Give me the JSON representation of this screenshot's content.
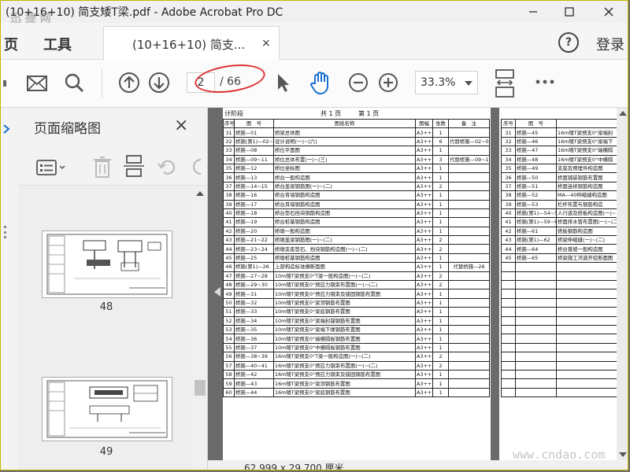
{
  "window": {
    "title": "(10+16+10)  简支矮T梁.pdf - Adobe Acrobat Pro DC",
    "watermark": "迅 捷 网",
    "controls": [
      "minimize",
      "maximize",
      "close"
    ]
  },
  "tabbar": {
    "nav_partial": "页",
    "tools": "工具",
    "doc_tab": "(10+16+10)  简支...",
    "close_glyph": "×",
    "help_glyph": "?",
    "login": "登录"
  },
  "toolbar": {
    "page_current": "2",
    "page_total": "/ 66",
    "zoom": "33.3%"
  },
  "sidebar": {
    "title": "页面缩略图",
    "close_glyph": "×",
    "thumbnails": [
      {
        "label": "48"
      },
      {
        "label": "49"
      }
    ]
  },
  "document": {
    "page1_header": {
      "left": "计阶段",
      "mid": "共 1 页",
      "right": "第 1 页"
    },
    "columns": [
      "序号",
      "图　号",
      "图纸名称",
      "图幅",
      "张数",
      "备　注"
    ],
    "rows": [
      [
        "31",
        "桥施—01",
        "桥梁总体图",
        "A3++",
        "1",
        ""
      ],
      [
        "32",
        "桥施(第1)—02~07",
        "设计说明(一)~(六)",
        "A3++",
        "6",
        "代替桥施—02~07"
      ],
      [
        "33",
        "桥施—08",
        "桥位平面图",
        "A3++",
        "1",
        ""
      ],
      [
        "34",
        "桥施—09~11",
        "桥位总体布置(一)~(三)",
        "A3++",
        "3",
        "代替桥施—09~11"
      ],
      [
        "35",
        "桥施—12",
        "桥位坐标图",
        "A3++",
        "1",
        ""
      ],
      [
        "36",
        "桥施—13",
        "桥台一般构造图",
        "A3++",
        "1",
        ""
      ],
      [
        "37",
        "桥施—14~15",
        "桥台盖梁钢筋图(一)~(二)",
        "A3++",
        "2",
        ""
      ],
      [
        "38",
        "桥施—16",
        "桥台背墙钢筋构造图",
        "A3++",
        "1",
        ""
      ],
      [
        "39",
        "桥施—17",
        "桥台耳墙钢筋构造图",
        "A3++",
        "1",
        ""
      ],
      [
        "40",
        "桥施—18",
        "桥台垫石挡块钢筋构造图",
        "A3++",
        "1",
        ""
      ],
      [
        "41",
        "桥施—19",
        "桥台桩基钢筋构造图",
        "A3++",
        "1",
        ""
      ],
      [
        "42",
        "桥施—20",
        "桥墩一般构造图",
        "A3++",
        "1",
        ""
      ],
      [
        "43",
        "桥施—21~22",
        "桥墩盖梁钢筋图(一)~(二)",
        "A3++",
        "2",
        ""
      ],
      [
        "44",
        "桥施—23~24",
        "桥墩支座垫石、挡块钢筋构造图(一)~(二)",
        "A3++",
        "2",
        ""
      ],
      [
        "45",
        "桥施—25",
        "桥墩桩基钢筋构造图",
        "A3++",
        "1",
        ""
      ],
      [
        "46",
        "桥施(第1)—26",
        "上部构造标准横断面图",
        "A3++",
        "1",
        "代替桥施—26"
      ],
      [
        "47",
        "桥施—27~28",
        "10m矮T梁预支0°T梁一般构造图(一)~(二)",
        "A3++",
        "2",
        ""
      ],
      [
        "48",
        "桥施—29~30",
        "10m矮T梁预支0°预应力钢束布置图(一)~(二)",
        "A3++",
        "2",
        ""
      ],
      [
        "49",
        "桥施—31",
        "10m矮T梁预支0°预应力钢束及锚固钢筋布置图",
        "A3++",
        "1",
        ""
      ],
      [
        "50",
        "桥施—32",
        "10m矮T梁预支0°梁顶钢筋布置图",
        "A3++",
        "1",
        ""
      ],
      [
        "51",
        "桥施—33",
        "10m矮T梁预支0°梁底钢筋布置图",
        "A3++",
        "1",
        ""
      ],
      [
        "52",
        "桥施—34",
        "10m矮T梁预支0°梁端封锚钢筋布置图",
        "A3++",
        "1",
        ""
      ],
      [
        "53",
        "桥施—35",
        "10m矮T梁预支0°梁端下缘钢筋布置图",
        "A3++",
        "1",
        ""
      ],
      [
        "54",
        "桥施—36",
        "10m矮T梁预支0°端横隔板钢筋布置图",
        "A3++",
        "1",
        ""
      ],
      [
        "55",
        "桥施—37",
        "10m矮T梁预支0°中横隔板钢筋布置图",
        "A3++",
        "1",
        ""
      ],
      [
        "56",
        "桥施—38~39",
        "16m矮T梁预支0°T梁一般构造图(一)~(二)",
        "A3++",
        "2",
        ""
      ],
      [
        "57",
        "桥施—40~41",
        "16m矮T梁预支0°预应力钢束布置图(一)~(二)",
        "A3++",
        "2",
        ""
      ],
      [
        "58",
        "桥施—42",
        "16m矮T梁预支0°预应力钢束及锚固钢筋布置图",
        "A3++",
        "1",
        ""
      ],
      [
        "59",
        "桥施—43",
        "16m矮T梁预支0°梁顶钢筋布置图",
        "A3++",
        "1",
        ""
      ],
      [
        "60",
        "桥施—44",
        "16m矮T梁预支0°梁底钢筋布置图",
        "A3++",
        "1",
        ""
      ]
    ],
    "page2_columns": [
      "序号",
      "图　号",
      ""
    ],
    "page2_rows": [
      [
        "31",
        "桥施—45",
        "16m矮T梁预支0°梁端封"
      ],
      [
        "32",
        "桥施—46",
        "16m矮T梁预支0°梁端下"
      ],
      [
        "33",
        "桥施—47",
        "16m矮T梁预支0°端横隔"
      ],
      [
        "34",
        "桥施—48",
        "16m矮T梁预支0°中横隔"
      ],
      [
        "35",
        "桥施—49",
        "支座及预埋件构造图"
      ],
      [
        "36",
        "桥施—50",
        "桥面铺装钢筋布置图"
      ],
      [
        "37",
        "桥施—51",
        "桥面连续钢筋构造图"
      ],
      [
        "38",
        "桥施—52",
        "MA—40伸缩缝构造图"
      ],
      [
        "39",
        "桥施—53",
        "栏杆布置与钢筋构造"
      ],
      [
        "40",
        "桥施(第1)—54~58",
        "人行道及搭板构造图(一)~"
      ],
      [
        "41",
        "桥施(第1)—59~60",
        "桥面排水管布置图(一)~(二"
      ],
      [
        "42",
        "桥施—61",
        "搭板钢筋构造图"
      ],
      [
        "43",
        "桥施(第1)—62",
        "桥梁伸缩缝(一)~(二)"
      ],
      [
        "44",
        "桥施—64",
        "桥台锥坡一般构造图"
      ],
      [
        "45",
        "桥施—65",
        "桥梁施工河道开挖断面图"
      ]
    ],
    "page_size": "62.999 x 29.700 厘米"
  },
  "footer_watermark": "www.cndao.com"
}
